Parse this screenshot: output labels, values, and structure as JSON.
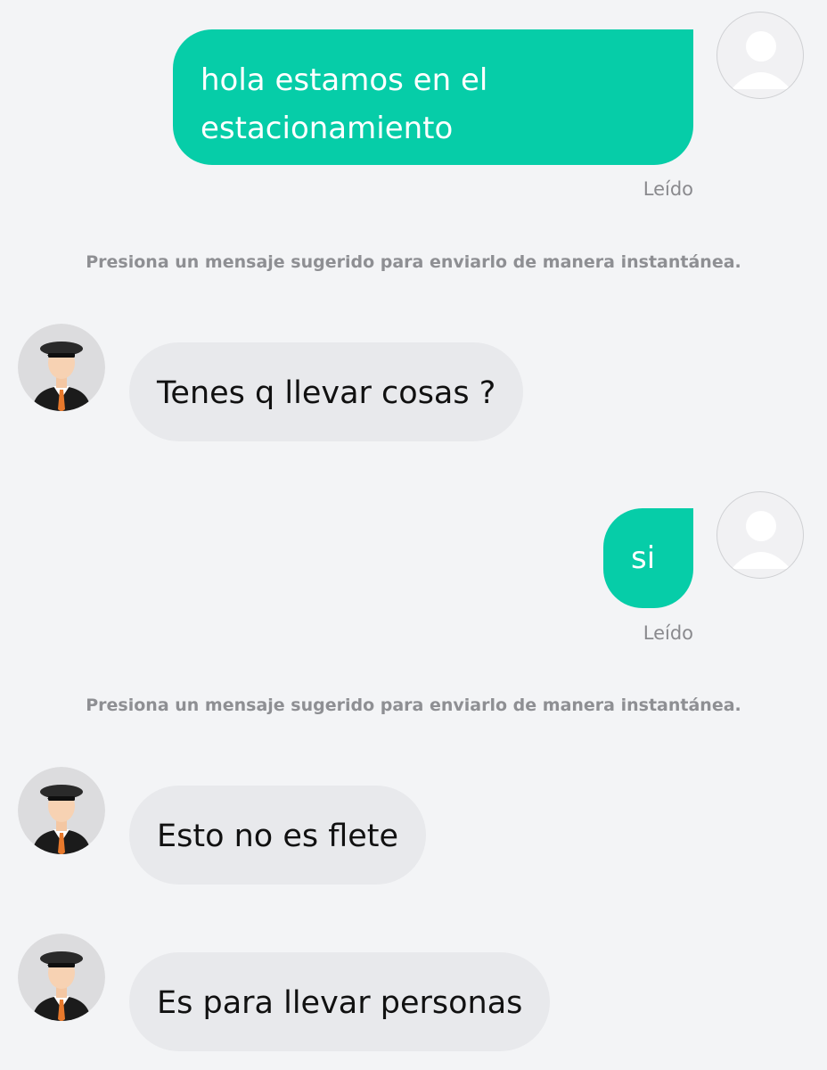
{
  "colors": {
    "outgoing_bubble": "#06cda8",
    "incoming_bubble": "#e8e9ec",
    "background": "#f3f4f6"
  },
  "messages": [
    {
      "sender": "user",
      "text_lines": [
        "hola estamos en el",
        "estacionamiento"
      ],
      "status": "Leído",
      "avatar_icon": "user-placeholder-icon"
    },
    {
      "sender": "driver",
      "text": "Tenes q llevar cosas ?",
      "avatar_icon": "driver-avatar-icon"
    },
    {
      "sender": "user",
      "text": "si",
      "status": "Leído",
      "avatar_icon": "user-placeholder-icon"
    },
    {
      "sender": "driver",
      "text": "Esto no es flete",
      "avatar_icon": "driver-avatar-icon"
    },
    {
      "sender": "driver",
      "text": "Es para llevar personas",
      "avatar_icon": "driver-avatar-icon"
    }
  ],
  "hints": [
    "Presiona un mensaje sugerido para enviarlo de manera instantánea.",
    "Presiona un mensaje sugerido para enviarlo de manera instantánea."
  ]
}
